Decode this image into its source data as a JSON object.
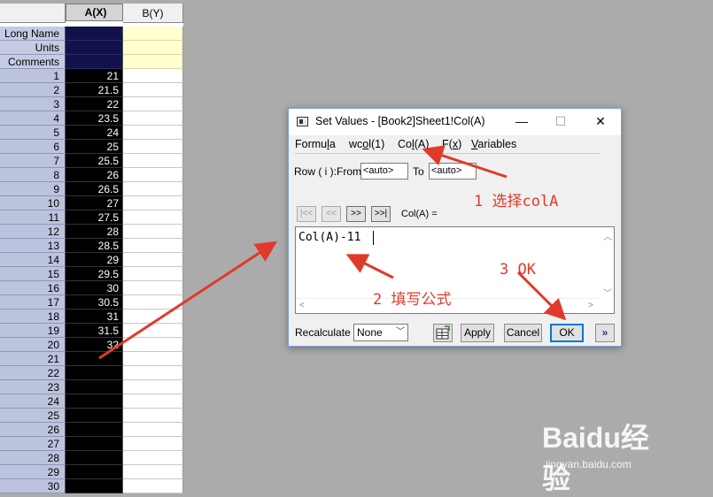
{
  "worksheet": {
    "col_a_header": "A(X)",
    "col_b_header": "B(Y)",
    "meta_rows": [
      "Long Name",
      "Units",
      "Comments"
    ],
    "rows": [
      {
        "n": "1",
        "a": "21"
      },
      {
        "n": "2",
        "a": "21.5"
      },
      {
        "n": "3",
        "a": "22"
      },
      {
        "n": "4",
        "a": "23.5"
      },
      {
        "n": "5",
        "a": "24"
      },
      {
        "n": "6",
        "a": "25"
      },
      {
        "n": "7",
        "a": "25.5"
      },
      {
        "n": "8",
        "a": "26"
      },
      {
        "n": "9",
        "a": "26.5"
      },
      {
        "n": "10",
        "a": "27"
      },
      {
        "n": "11",
        "a": "27.5"
      },
      {
        "n": "12",
        "a": "28"
      },
      {
        "n": "13",
        "a": "28.5"
      },
      {
        "n": "14",
        "a": "29"
      },
      {
        "n": "15",
        "a": "29.5"
      },
      {
        "n": "16",
        "a": "30"
      },
      {
        "n": "17",
        "a": "30.5"
      },
      {
        "n": "18",
        "a": "31"
      },
      {
        "n": "19",
        "a": "31.5"
      },
      {
        "n": "20",
        "a": "32"
      },
      {
        "n": "21",
        "a": ""
      },
      {
        "n": "22",
        "a": ""
      },
      {
        "n": "23",
        "a": ""
      },
      {
        "n": "24",
        "a": ""
      },
      {
        "n": "25",
        "a": ""
      },
      {
        "n": "26",
        "a": ""
      },
      {
        "n": "27",
        "a": ""
      },
      {
        "n": "28",
        "a": ""
      },
      {
        "n": "29",
        "a": ""
      },
      {
        "n": "30",
        "a": ""
      }
    ]
  },
  "dialog": {
    "title": "Set Values - [Book2]Sheet1!Col(A)",
    "minimize": "—",
    "maximize": "☐",
    "close": "✕",
    "menus": [
      "Formula",
      "wcol(1)",
      "Col(A)",
      "F(x)",
      "Variables"
    ],
    "row_label": "Row ( i ):",
    "from_label": "From",
    "from_value": "<auto>",
    "to_label": "To",
    "to_value": "<auto>",
    "nav_buttons": [
      "|<<",
      "<<",
      ">>",
      ">>|"
    ],
    "col_eq": "Col(A) =",
    "formula": "Col(A)-11",
    "recalc_label": "Recalculate",
    "recalc_value": "None",
    "apply": "Apply",
    "cancel": "Cancel",
    "ok": "OK",
    "expand": "»"
  },
  "annotations": {
    "step1": "1 选择colA",
    "step2": "2 填写公式",
    "step3": "3 OK",
    "arrow_color": "#e03a2a"
  },
  "watermark": {
    "logo": "Baidu经验",
    "url": "jingyan.baidu.com"
  }
}
